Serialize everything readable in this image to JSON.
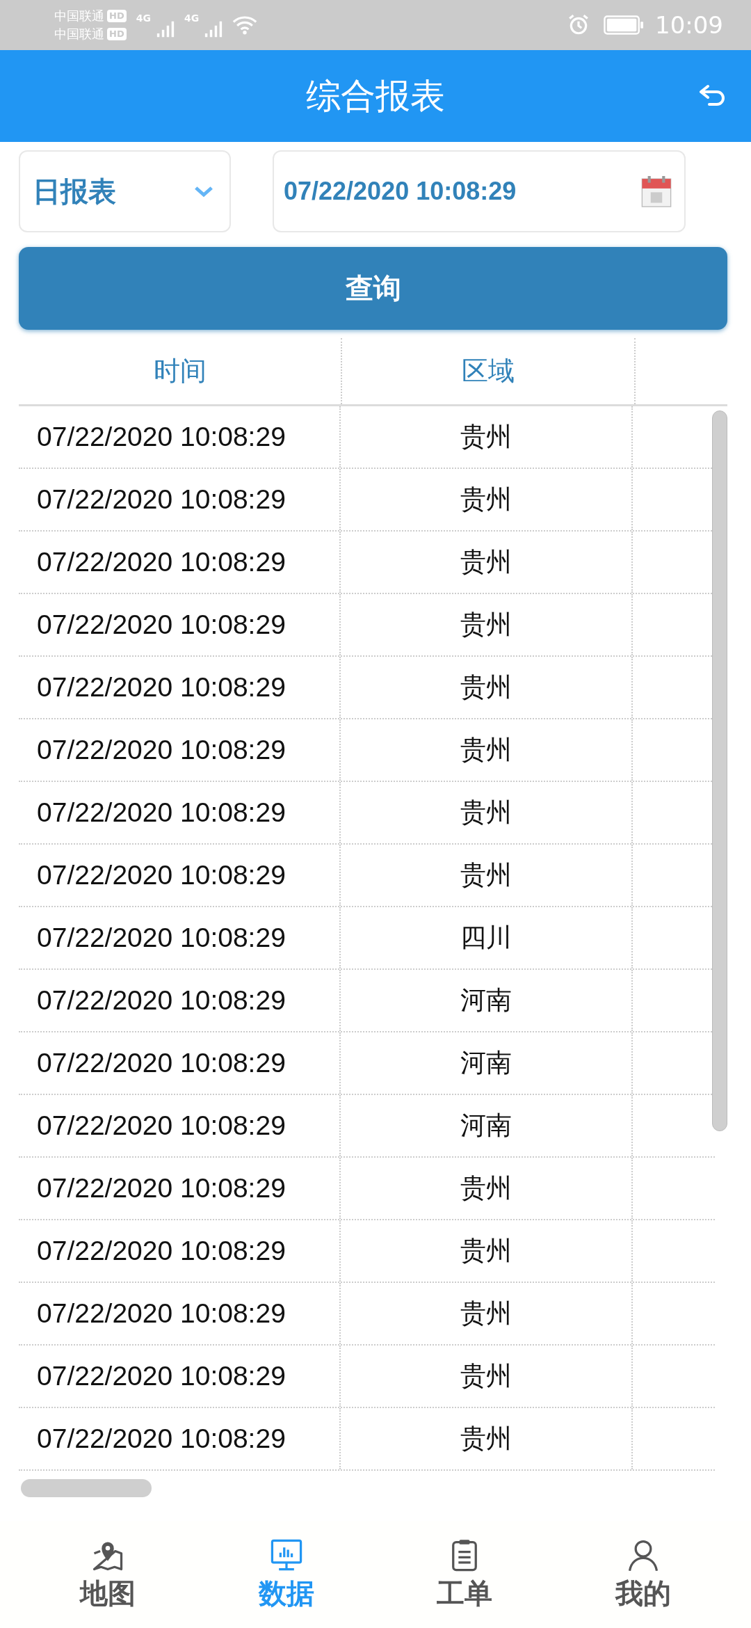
{
  "status_bar": {
    "carrier_1": "中国联通",
    "carrier_2": "中国联通",
    "hd_1": "HD",
    "hd_2": "HD",
    "net_1": "4G",
    "net_2": "4G",
    "time": "10:09"
  },
  "header": {
    "title": "综合报表"
  },
  "filters": {
    "report_type": "日报表",
    "date": "07/22/2020 10:08:29"
  },
  "query_button": "查询",
  "table": {
    "columns": [
      "时间",
      "区域"
    ],
    "rows": [
      [
        "07/22/2020 10:08:29",
        "贵州"
      ],
      [
        "07/22/2020 10:08:29",
        "贵州"
      ],
      [
        "07/22/2020 10:08:29",
        "贵州"
      ],
      [
        "07/22/2020 10:08:29",
        "贵州"
      ],
      [
        "07/22/2020 10:08:29",
        "贵州"
      ],
      [
        "07/22/2020 10:08:29",
        "贵州"
      ],
      [
        "07/22/2020 10:08:29",
        "贵州"
      ],
      [
        "07/22/2020 10:08:29",
        "贵州"
      ],
      [
        "07/22/2020 10:08:29",
        "四川"
      ],
      [
        "07/22/2020 10:08:29",
        "河南"
      ],
      [
        "07/22/2020 10:08:29",
        "河南"
      ],
      [
        "07/22/2020 10:08:29",
        "河南"
      ],
      [
        "07/22/2020 10:08:29",
        "贵州"
      ],
      [
        "07/22/2020 10:08:29",
        "贵州"
      ],
      [
        "07/22/2020 10:08:29",
        "贵州"
      ],
      [
        "07/22/2020 10:08:29",
        "贵州"
      ],
      [
        "07/22/2020 10:08:29",
        "贵州"
      ]
    ]
  },
  "tab_bar": [
    {
      "label": "地图",
      "kind": "map",
      "selected": false
    },
    {
      "label": "数据",
      "kind": "data",
      "selected": true
    },
    {
      "label": "工单",
      "kind": "order",
      "selected": false
    },
    {
      "label": "我的",
      "kind": "me",
      "selected": false
    }
  ]
}
